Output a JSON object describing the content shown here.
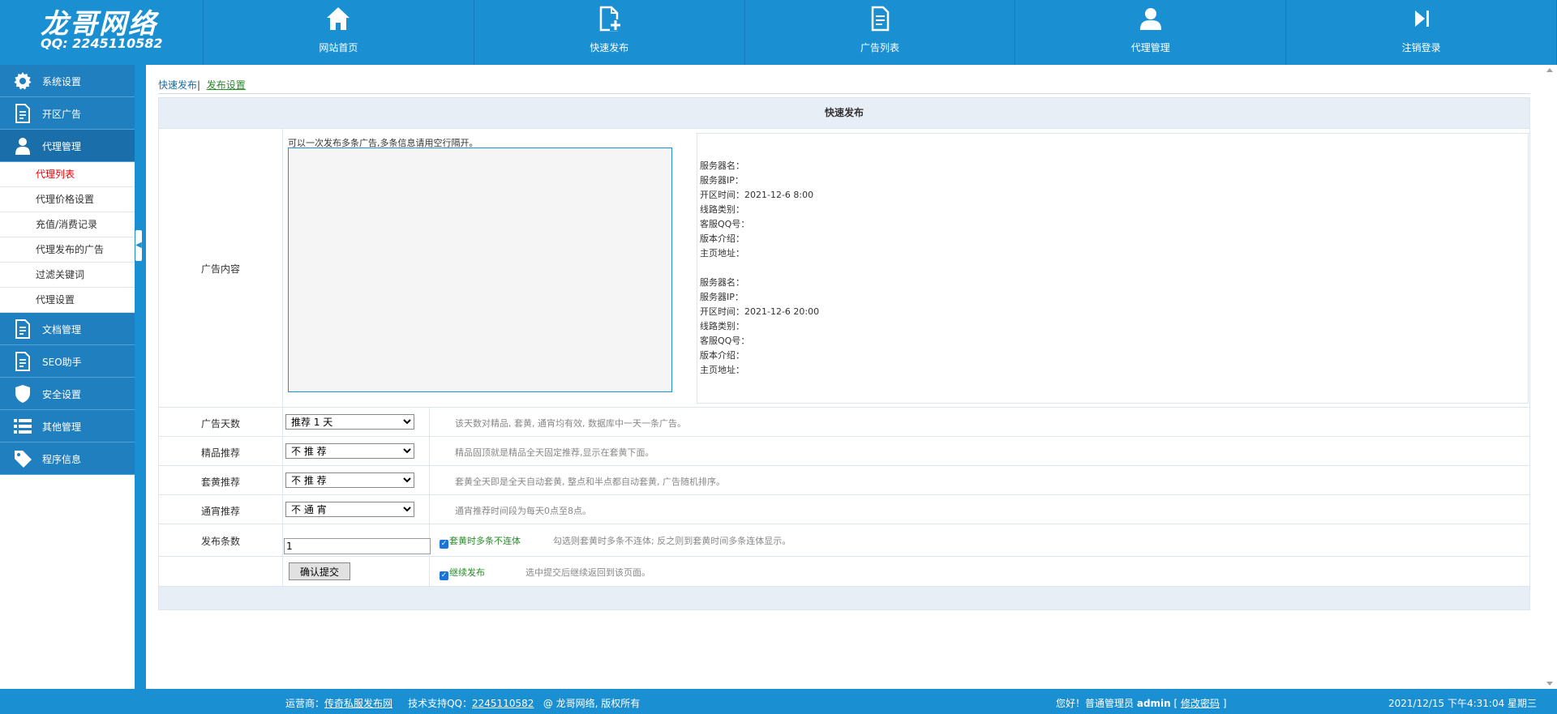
{
  "header": {
    "brand": "龙哥网络",
    "qq": "QQ: 2245110582",
    "nav": [
      {
        "label": "网站首页",
        "icon": "home-icon"
      },
      {
        "label": "快速发布",
        "icon": "document-add-icon"
      },
      {
        "label": "广告列表",
        "icon": "document-icon"
      },
      {
        "label": "代理管理",
        "icon": "user-icon"
      },
      {
        "label": "注销登录",
        "icon": "logout-icon"
      }
    ]
  },
  "sidebar": {
    "groups_top": [
      {
        "label": "系统设置",
        "icon": "gear-icon"
      },
      {
        "label": "开区广告",
        "icon": "document-icon"
      },
      {
        "label": "代理管理",
        "icon": "user-icon"
      }
    ],
    "sub_items": [
      "代理列表",
      "代理价格设置",
      "充值/消费记录",
      "代理发布的广告",
      "过滤关键词",
      "代理设置"
    ],
    "groups_bottom": [
      {
        "label": "文档管理",
        "icon": "document-icon"
      },
      {
        "label": "SEO助手",
        "icon": "document-icon"
      },
      {
        "label": "安全设置",
        "icon": "shield-icon"
      },
      {
        "label": "其他管理",
        "icon": "list-icon"
      },
      {
        "label": "程序信息",
        "icon": "tag-icon"
      }
    ]
  },
  "tabs": {
    "quick_publish": "快速发布",
    "separator": "|",
    "publish_settings": "发布设置"
  },
  "form": {
    "title": "快速发布",
    "content_label": "广告内容",
    "content_hint": "可以一次发布多条广告,多条信息请用空行隔开。",
    "content_value": "",
    "servers": [
      [
        "服务器名：",
        "服务器IP：",
        "开区时间：2021-12-6 8:00",
        "线路类别：",
        "客服QQ号：",
        "版本介绍：",
        "主页地址："
      ],
      [
        "服务器名：",
        "服务器IP：",
        "开区时间：2021-12-6 20:00",
        "线路类别：",
        "客服QQ号：",
        "版本介绍：",
        "主页地址："
      ]
    ],
    "days": {
      "label": "广告天数",
      "value": "推荐 1 天",
      "note": "该天数对精品, 套黄, 通宵均有效, 数据库中一天一条广告。"
    },
    "premium": {
      "label": "精品推荐",
      "value": "不 推 荐",
      "note": "精品固顶就是精品全天固定推荐,显示在套黄下面。"
    },
    "gold": {
      "label": "套黄推荐",
      "value": "不 推 荐",
      "note": "套黄全天即是全天自动套黄, 整点和半点都自动套黄, 广告随机排序。"
    },
    "night": {
      "label": "通宵推荐",
      "value": "不 通 宵",
      "note": "通宵推荐时间段为每天0点至8点。"
    },
    "count": {
      "label": "发布条数",
      "value": "1",
      "checkbox": "套黄时多条不连体",
      "note": "勾选则套黄时多条不连体; 反之则到套黄时间多条连体显示。"
    },
    "submit": {
      "button": "确认提交",
      "checkbox": "继续发布",
      "note": "选中提交后继续返回到该页面。"
    }
  },
  "footer": {
    "operator_prefix": "运营商：",
    "operator_link": "传奇私服发布网",
    "support_prefix": "技术支持QQ：",
    "support_link": "2245110582",
    "copyright": "@ 龙哥网络, 版权所有",
    "greeting": "您好！普通管理员",
    "user": "admin",
    "bracket_open": "[",
    "change_pwd": "修改密码",
    "bracket_close": "]",
    "datetime": "2021/12/15 下午4:31:04 星期三"
  }
}
